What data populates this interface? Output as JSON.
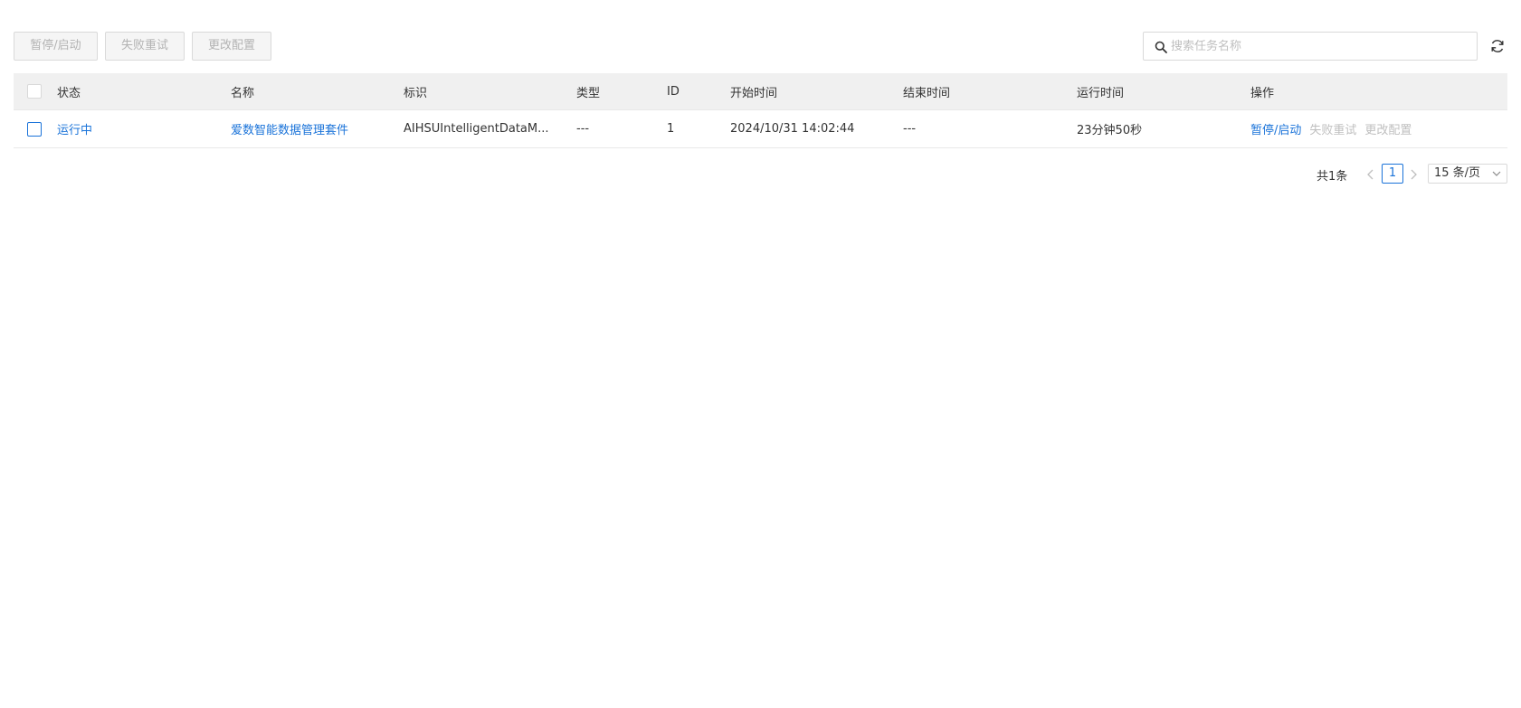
{
  "toolbar": {
    "pause_start_label": "暂停/启动",
    "retry_failed_label": "失败重试",
    "change_config_label": "更改配置",
    "search_placeholder": "搜索任务名称",
    "search_value": ""
  },
  "table": {
    "columns": {
      "status": "状态",
      "name": "名称",
      "identifier": "标识",
      "type": "类型",
      "id": "ID",
      "start_time": "开始时间",
      "end_time": "结束时间",
      "run_time": "运行时间",
      "operations": "操作"
    },
    "rows": [
      {
        "status": "运行中",
        "name": "爱数智能数据管理套件",
        "identifier": "AIHSUIntelligentDataM...",
        "type": "---",
        "id": "1",
        "start_time": "2024/10/31 14:02:44",
        "end_time": "---",
        "run_time": "23分钟50秒",
        "ops": {
          "pause_start": "暂停/启动",
          "retry_failed": "失败重试",
          "change_config": "更改配置"
        }
      }
    ]
  },
  "pagination": {
    "total": "共1条",
    "current_page": "1",
    "page_size": "15 条/页"
  },
  "colors": {
    "accent": "#1a73d9",
    "disabled": "#bfbfbf",
    "header_bg": "#f0f0f0"
  }
}
